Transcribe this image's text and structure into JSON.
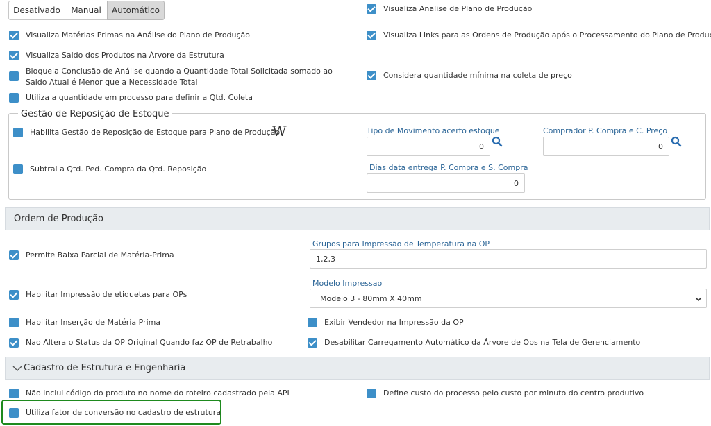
{
  "mode_selector": {
    "options": [
      "Desativado",
      "Manual",
      "Automático"
    ],
    "active": "Automático"
  },
  "top_options": {
    "visualiza_materias": "Visualiza Matérias Primas na Análise do Plano de Produção",
    "visualiza_saldo": "Visualiza Saldo dos Produtos na Árvore da Estrutura",
    "bloqueia_conclusao": "Bloqueia Conclusão de Análise quando a Quantidade Total Solicitada somado ao Saldo Atual é Menor que a Necessidade Total",
    "utiliza_qtd_processo": "Utiliza a quantidade em processo para definir a Qtd. Coleta",
    "visualiza_analise": "Visualiza Analise de Plano de Produção",
    "visualiza_links": "Visualiza Links para as Ordens de Produção após o Processamento do Plano de Produção",
    "considera_qtd_minima": "Considera quantidade mínima na coleta de preço"
  },
  "reposicao": {
    "title": "Gestão de Reposição de Estoque",
    "habilita": "Habilita Gestão de Reposição de Estoque para Plano de Produção",
    "w_icon_text": "W",
    "subtrai": "Subtrai a Qtd. Ped. Compra da Qtd. Reposição",
    "tipo_movimento_label": "Tipo de Movimento acerto estoque",
    "tipo_movimento_value": "0",
    "comprador_label": "Comprador P. Compra e C. Preço",
    "comprador_value": "0",
    "dias_entrega_label": "Dias data entrega P. Compra e S. Compra",
    "dias_entrega_value": "0"
  },
  "ordem_producao": {
    "title": "Ordem de Produção",
    "permite_baixa": "Permite Baixa Parcial de Matéria-Prima",
    "grupos_label": "Grupos para Impressão de Temperatura na OP",
    "grupos_value": "1,2,3",
    "habilitar_etiquetas": "Habilitar Impressão de etiquetas para OPs",
    "modelo_label": "Modelo Impressao",
    "modelo_value": "Modelo 3 - 80mm X 40mm",
    "habilitar_insercao": "Habilitar Inserção de Matéria Prima",
    "exibir_vendedor": "Exibir Vendedor na Impressão da OP",
    "nao_altera_status": "Nao Altera o Status da OP Original Quando faz OP de Retrabalho",
    "desabilitar_carregamento": "Desabilitar Carregamento Automático da Árvore de Ops na Tela de Gerenciamento"
  },
  "cadastro_estrutura": {
    "title": "Cadastro de Estrutura e Engenharia",
    "nao_inclui_codigo": "Não inclui código do produto no nome do roteiro cadastrado pela API",
    "define_custo": "Define custo do processo pelo custo por minuto do centro produtivo",
    "utiliza_fator": "Utiliza fator de conversão no cadastro de estrutura"
  },
  "colors": {
    "checkbox": "#3d8fc8",
    "label_blue": "#2a6496",
    "highlight_border": "#1e8a1e",
    "panel_header_bg": "#e8ecef"
  }
}
